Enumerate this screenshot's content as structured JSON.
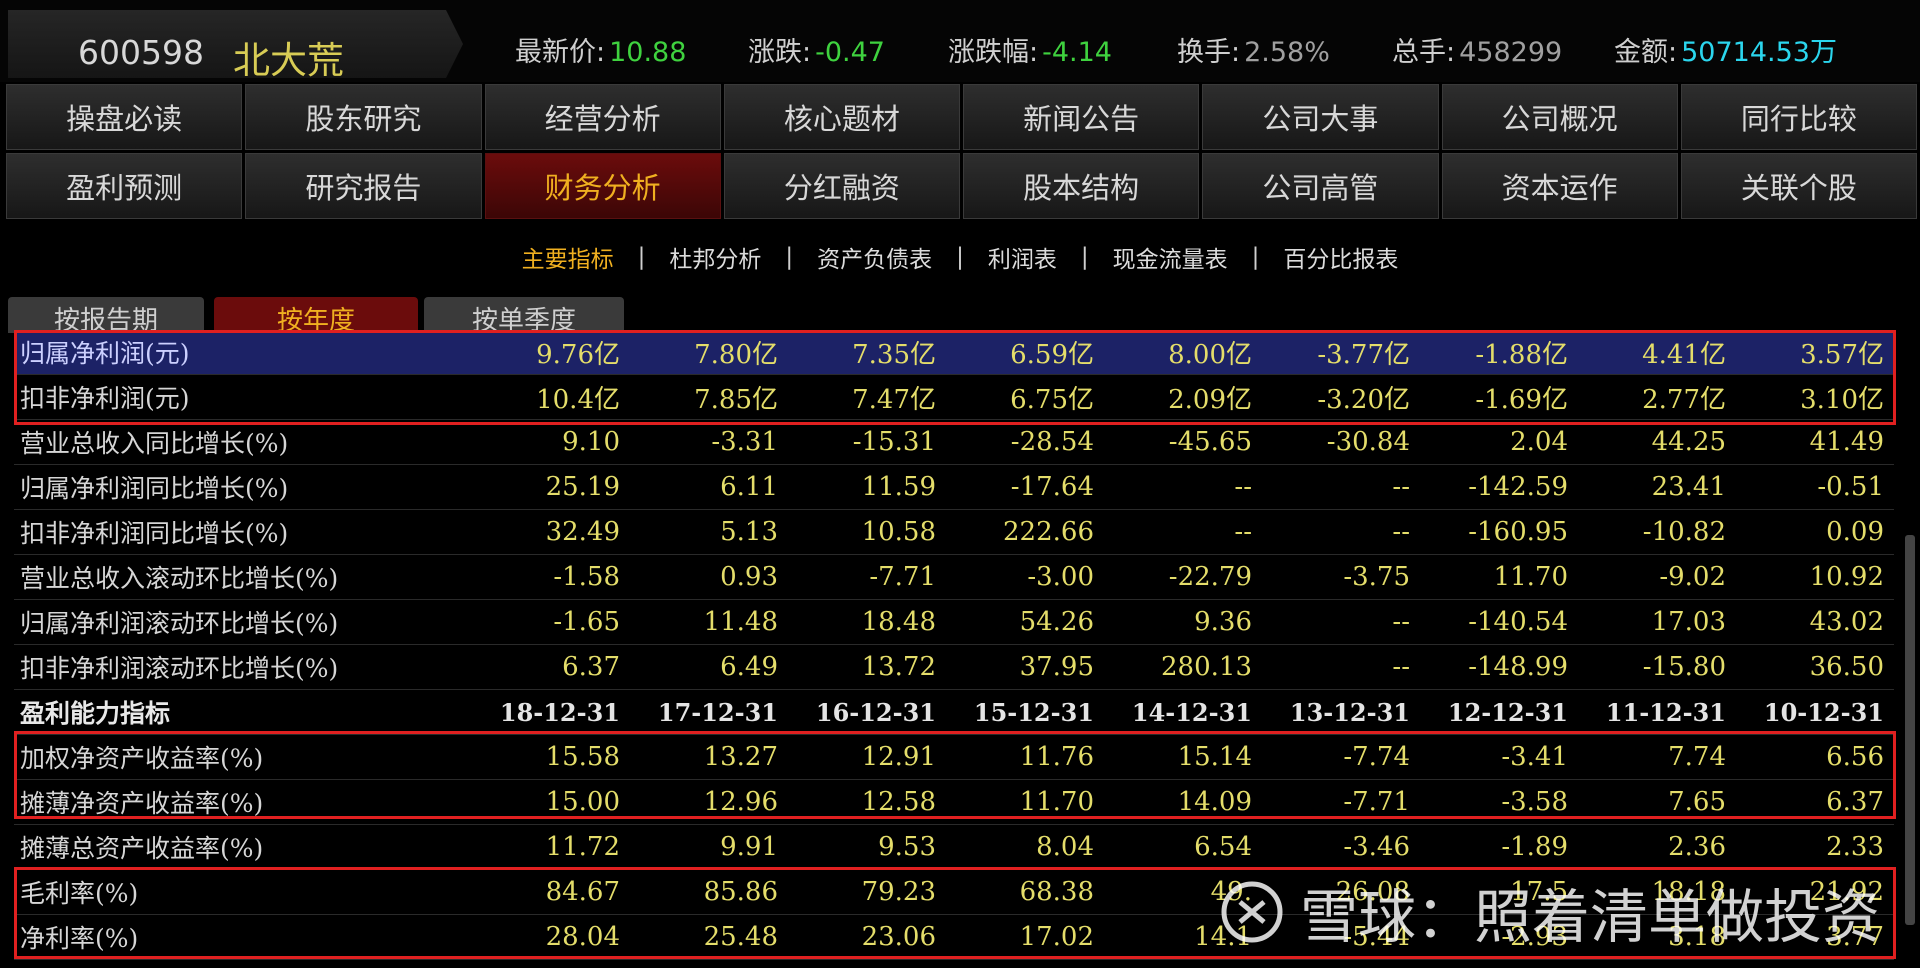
{
  "stock": {
    "code": "600598",
    "name": "北大荒"
  },
  "quote": {
    "latest_label": "最新价:",
    "latest": "10.88",
    "change_label": "涨跌:",
    "change": "-0.47",
    "pct_label": "涨跌幅:",
    "pct": "-4.14",
    "turnover_label": "换手:",
    "turnover": "2.58%",
    "volume_label": "总手:",
    "volume": "458299",
    "amount_label": "金额:",
    "amount": "50714.53万"
  },
  "nav_row1": [
    "操盘必读",
    "股东研究",
    "经营分析",
    "核心题材",
    "新闻公告",
    "公司大事",
    "公司概况",
    "同行比较"
  ],
  "nav_row2": [
    "盈利预测",
    "研究报告",
    "财务分析",
    "分红融资",
    "股本结构",
    "公司高管",
    "资本运作",
    "关联个股"
  ],
  "subnav": [
    "主要指标",
    "杜邦分析",
    "资产负债表",
    "利润表",
    "现金流量表",
    "百分比报表"
  ],
  "period_tabs": [
    "按报告期",
    "按年度",
    "按单季度"
  ],
  "rows": [
    {
      "label": "归属净利润(元)",
      "values": [
        "9.76亿",
        "7.80亿",
        "7.35亿",
        "6.59亿",
        "8.00亿",
        "-3.77亿",
        "-1.88亿",
        "4.41亿",
        "3.57亿"
      ]
    },
    {
      "label": "扣非净利润(元)",
      "values": [
        "10.4亿",
        "7.85亿",
        "7.47亿",
        "6.75亿",
        "2.09亿",
        "-3.20亿",
        "-1.69亿",
        "2.77亿",
        "3.10亿"
      ]
    },
    {
      "label": "营业总收入同比增长(%)",
      "values": [
        "9.10",
        "-3.31",
        "-15.31",
        "-28.54",
        "-45.65",
        "-30.84",
        "2.04",
        "44.25",
        "41.49"
      ]
    },
    {
      "label": "归属净利润同比增长(%)",
      "values": [
        "25.19",
        "6.11",
        "11.59",
        "-17.64",
        "--",
        "--",
        "-142.59",
        "23.41",
        "-0.51"
      ]
    },
    {
      "label": "扣非净利润同比增长(%)",
      "values": [
        "32.49",
        "5.13",
        "10.58",
        "222.66",
        "--",
        "--",
        "-160.95",
        "-10.82",
        "0.09"
      ]
    },
    {
      "label": "营业总收入滚动环比增长(%)",
      "values": [
        "-1.58",
        "0.93",
        "-7.71",
        "-3.00",
        "-22.79",
        "-3.75",
        "11.70",
        "-9.02",
        "10.92"
      ]
    },
    {
      "label": "归属净利润滚动环比增长(%)",
      "values": [
        "-1.65",
        "11.48",
        "18.48",
        "54.26",
        "9.36",
        "--",
        "-140.54",
        "17.03",
        "43.02"
      ]
    },
    {
      "label": "扣非净利润滚动环比增长(%)",
      "values": [
        "6.37",
        "6.49",
        "13.72",
        "37.95",
        "280.13",
        "--",
        "-148.99",
        "-15.80",
        "36.50"
      ]
    },
    {
      "label": "盈利能力指标",
      "values": [
        "18-12-31",
        "17-12-31",
        "16-12-31",
        "15-12-31",
        "14-12-31",
        "13-12-31",
        "12-12-31",
        "11-12-31",
        "10-12-31"
      ]
    },
    {
      "label": "加权净资产收益率(%)",
      "values": [
        "15.58",
        "13.27",
        "12.91",
        "11.76",
        "15.14",
        "-7.74",
        "-3.41",
        "7.74",
        "6.56"
      ]
    },
    {
      "label": "摊薄净资产收益率(%)",
      "values": [
        "15.00",
        "12.96",
        "12.58",
        "11.70",
        "14.09",
        "-7.71",
        "-3.58",
        "7.65",
        "6.37"
      ]
    },
    {
      "label": "摊薄总资产收益率(%)",
      "values": [
        "11.72",
        "9.91",
        "9.53",
        "8.04",
        "6.54",
        "-3.46",
        "-1.89",
        "2.36",
        "2.33"
      ]
    },
    {
      "label": "毛利率(%)",
      "values": [
        "84.67",
        "85.86",
        "79.23",
        "68.38",
        "49.",
        "26.08",
        "17.5",
        "18.18",
        "21.92"
      ]
    },
    {
      "label": "净利率(%)",
      "values": [
        "28.04",
        "25.48",
        "23.06",
        "17.02",
        "14.1",
        "-5.44",
        "-2.93",
        "3.18",
        "3.77"
      ]
    }
  ],
  "watermark": "雪球：照着清单做投资",
  "colors": {
    "gain": "#3fd23f",
    "accent": "#f0b020",
    "active_bg": "#6b0c0c",
    "highlight_row": "#1c2266",
    "box": "#e02020",
    "value_text": "#e4dd6a"
  }
}
